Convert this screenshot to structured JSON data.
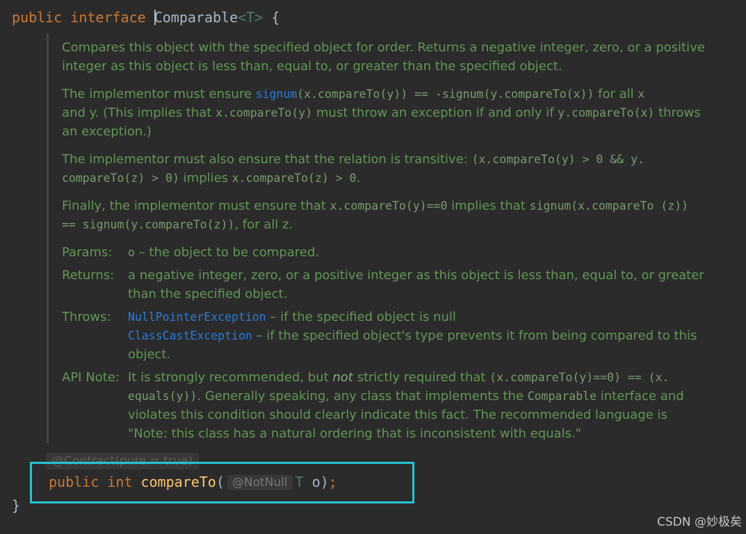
{
  "signature": {
    "kw_public": "public",
    "kw_interface": "interface",
    "class_name": "Comparable",
    "type_param": "<T>",
    "open_brace": "{"
  },
  "doc": {
    "p1": "Compares this object with the specified object for order. Returns a negative integer, zero, or a positive integer as this object is less than, equal to, or greater than the specified object.",
    "p2": {
      "t1": "The implementor must ensure ",
      "c1": "signum",
      "c2": "(x.compareTo(y)) == -signum(y.compareTo(x))",
      "t2": " for all ",
      "c3": "x",
      "t3": " and ",
      "c4": "y",
      "t4": ". (This implies that ",
      "c5": "x.compareTo(y)",
      "t5": " must throw an exception if and only if ",
      "c6": "y.compareTo(x)",
      "t6": " throws an exception.)"
    },
    "p3": {
      "t1": "The implementor must also ensure that the relation is transitive: ",
      "c1": "(x.compareTo(y) > 0 && y. compareTo(z) > 0)",
      "t2": " implies ",
      "c2": "x.compareTo(z) > 0",
      "t3": "."
    },
    "p4": {
      "t1": "Finally, the implementor must ensure that ",
      "c1": "x.compareTo(y)==0",
      "t2": " implies that ",
      "c2": "signum(x.compareTo (z)) == signum(y.compareTo(z))",
      "t3": ", for all ",
      "c3": "z",
      "t4": "."
    },
    "params": {
      "label": "Params:",
      "name": "o",
      "desc": " – the object to be compared."
    },
    "returns": {
      "label": "Returns:",
      "desc": "a negative integer, zero, or a positive integer as this object is less than, equal to, or greater than the specified object."
    },
    "throws": {
      "label": "Throws:",
      "ex1": "NullPointerException",
      "ex1_desc": " – if the specified object is null",
      "ex2": "ClassCastException",
      "ex2_desc": " – if the specified object's type prevents it from being compared to this object."
    },
    "api_note": {
      "label": "API Note:",
      "t1": "It is strongly recommended, but ",
      "em": "not",
      "t2": " strictly required that ",
      "c1": "(x.compareTo(y)==0) == (x. equals(y))",
      "t3": ". Generally speaking, any class that implements the ",
      "c2": "Comparable",
      "t4": " interface and violates this condition should clearly indicate this fact. The recommended language is \"Note: this class has a natural ordering that is inconsistent with equals.\""
    }
  },
  "contract_hint": "@Contract(pure = true)",
  "method": {
    "kw_public": "public",
    "kw_int": "int",
    "name": "compareTo",
    "paren_open": "(",
    "annotation_hint": "@NotNull",
    "param_type": "T",
    "param_name": "o",
    "paren_close": ")",
    "semicolon": ";"
  },
  "close_brace": "}",
  "watermark": "CSDN @妙极矣",
  "colors": {
    "keyword": "#cc7832",
    "method": "#ffc66d",
    "doc_text": "#629755",
    "link": "#287bde",
    "highlight_box": "#22c6d4",
    "background": "#2b2b2b"
  }
}
